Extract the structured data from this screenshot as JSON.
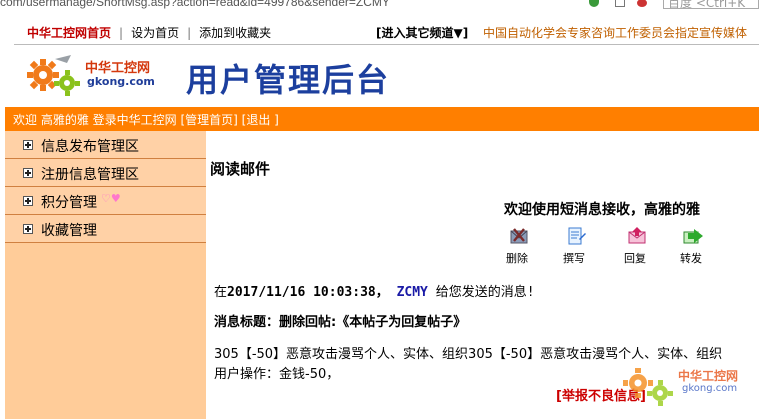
{
  "browser": {
    "url": "com/usermanage/ShortMsg.asp?action=read&id=499786&sender=ZCMY",
    "search_placeholder": "百度 <Ctrl+K"
  },
  "topbar": {
    "home": "中华工控网首页",
    "set_home": "设为首页",
    "add_fav": "添加到收藏夹",
    "other_channels": "[进入其它频道▼]",
    "note": "中国自动化学会专家咨询工作委员会指定宣传媒体"
  },
  "header": {
    "logo_brand": "中华工控网",
    "logo_domain": "gkong.com",
    "title": "用户管理后台"
  },
  "userbar": {
    "welcome": "欢迎 高雅的雅 登录中华工控网",
    "manage_home": "[管理首页]",
    "logout": "[退出 ]"
  },
  "sidebar": {
    "items": [
      {
        "label": "信息发布管理区"
      },
      {
        "label": "注册信息管理区"
      },
      {
        "label": "积分管理"
      },
      {
        "label": "收藏管理"
      }
    ]
  },
  "main": {
    "read_title": "阅读邮件",
    "welcome": "欢迎使用短消息接收，高雅的雅",
    "actions": {
      "delete": "删除",
      "compose": "撰写",
      "reply": "回复",
      "forward": "转发"
    },
    "msg_prefix": "在",
    "msg_time": "2017/11/16 10:03:38，",
    "msg_sender": "ZCMY",
    "msg_suffix": "给您发送的消息!",
    "subject_label": "消息标题：删除回帖:《本帖子为回复帖子》",
    "body_line1": "305【-50】恶意攻击漫骂个人、实体、组织305【-50】恶意攻击漫骂个人、实体、组织",
    "body_line2": "用户操作：金钱-50，",
    "report": "[举报不良信息]"
  },
  "watermark": {
    "brand": "中华工控网",
    "domain": "gkong.com"
  },
  "colors": {
    "accent_orange": "#ff7f00",
    "sidebar_bg": "#ffcc99",
    "title_blue": "#1c3f9e",
    "link_red": "#c00000"
  }
}
